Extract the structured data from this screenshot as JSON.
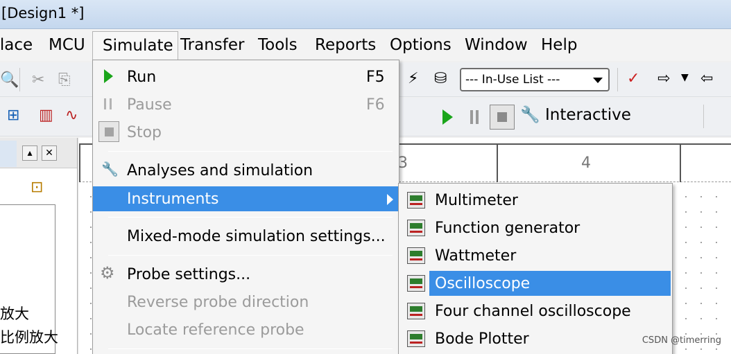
{
  "window": {
    "title": "[Design1 *]"
  },
  "menubar": {
    "items": [
      {
        "id": "place",
        "label": "Place"
      },
      {
        "id": "mcu",
        "label": "MCU"
      },
      {
        "id": "simulate",
        "label": "Simulate"
      },
      {
        "id": "transfer",
        "label": "Transfer"
      },
      {
        "id": "tools",
        "label": "Tools"
      },
      {
        "id": "reports",
        "label": "Reports"
      },
      {
        "id": "options",
        "label": "Options"
      },
      {
        "id": "window",
        "label": "Window"
      },
      {
        "id": "help",
        "label": "Help"
      }
    ]
  },
  "toolbar": {
    "in_use_list": "--- In-Use List ---",
    "interactive_label": "Interactive"
  },
  "canvas": {
    "ruler_labels": [
      "3",
      "4"
    ]
  },
  "left_panel": {
    "items": [
      "放大",
      "比例放大"
    ]
  },
  "simulate_menu": {
    "items": [
      {
        "label": "Run",
        "shortcut": "F5",
        "disabled": false,
        "icon": "play-icon"
      },
      {
        "label": "Pause",
        "shortcut": "F6",
        "disabled": true,
        "icon": "pause-icon"
      },
      {
        "label": "Stop",
        "shortcut": "",
        "disabled": true,
        "icon": "stop-icon"
      },
      {
        "label": "Analyses and simulation",
        "shortcut": "",
        "disabled": false,
        "icon": "wrench-icon"
      },
      {
        "label": "Instruments",
        "shortcut": "",
        "disabled": false,
        "highlighted": true
      },
      {
        "label": "Mixed-mode simulation settings...",
        "shortcut": "",
        "disabled": false
      },
      {
        "label": "Probe settings...",
        "shortcut": "",
        "disabled": false,
        "icon": "gear-icon"
      },
      {
        "label": "Reverse probe direction",
        "shortcut": "",
        "disabled": true
      },
      {
        "label": "Locate reference probe",
        "shortcut": "",
        "disabled": true
      }
    ]
  },
  "instruments_menu": {
    "items": [
      {
        "label": "Multimeter",
        "icon": "multimeter-icon"
      },
      {
        "label": "Function generator",
        "icon": "function-generator-icon"
      },
      {
        "label": "Wattmeter",
        "icon": "wattmeter-icon"
      },
      {
        "label": "Oscilloscope",
        "icon": "oscilloscope-icon",
        "highlighted": true
      },
      {
        "label": "Four channel oscilloscope",
        "icon": "four-channel-oscilloscope-icon"
      },
      {
        "label": "Bode Plotter",
        "icon": "bode-plotter-icon"
      }
    ]
  },
  "watermark": "CSDN @timerring",
  "colors": {
    "highlight": "#3a8ee6",
    "run_green": "#1aa51a"
  }
}
